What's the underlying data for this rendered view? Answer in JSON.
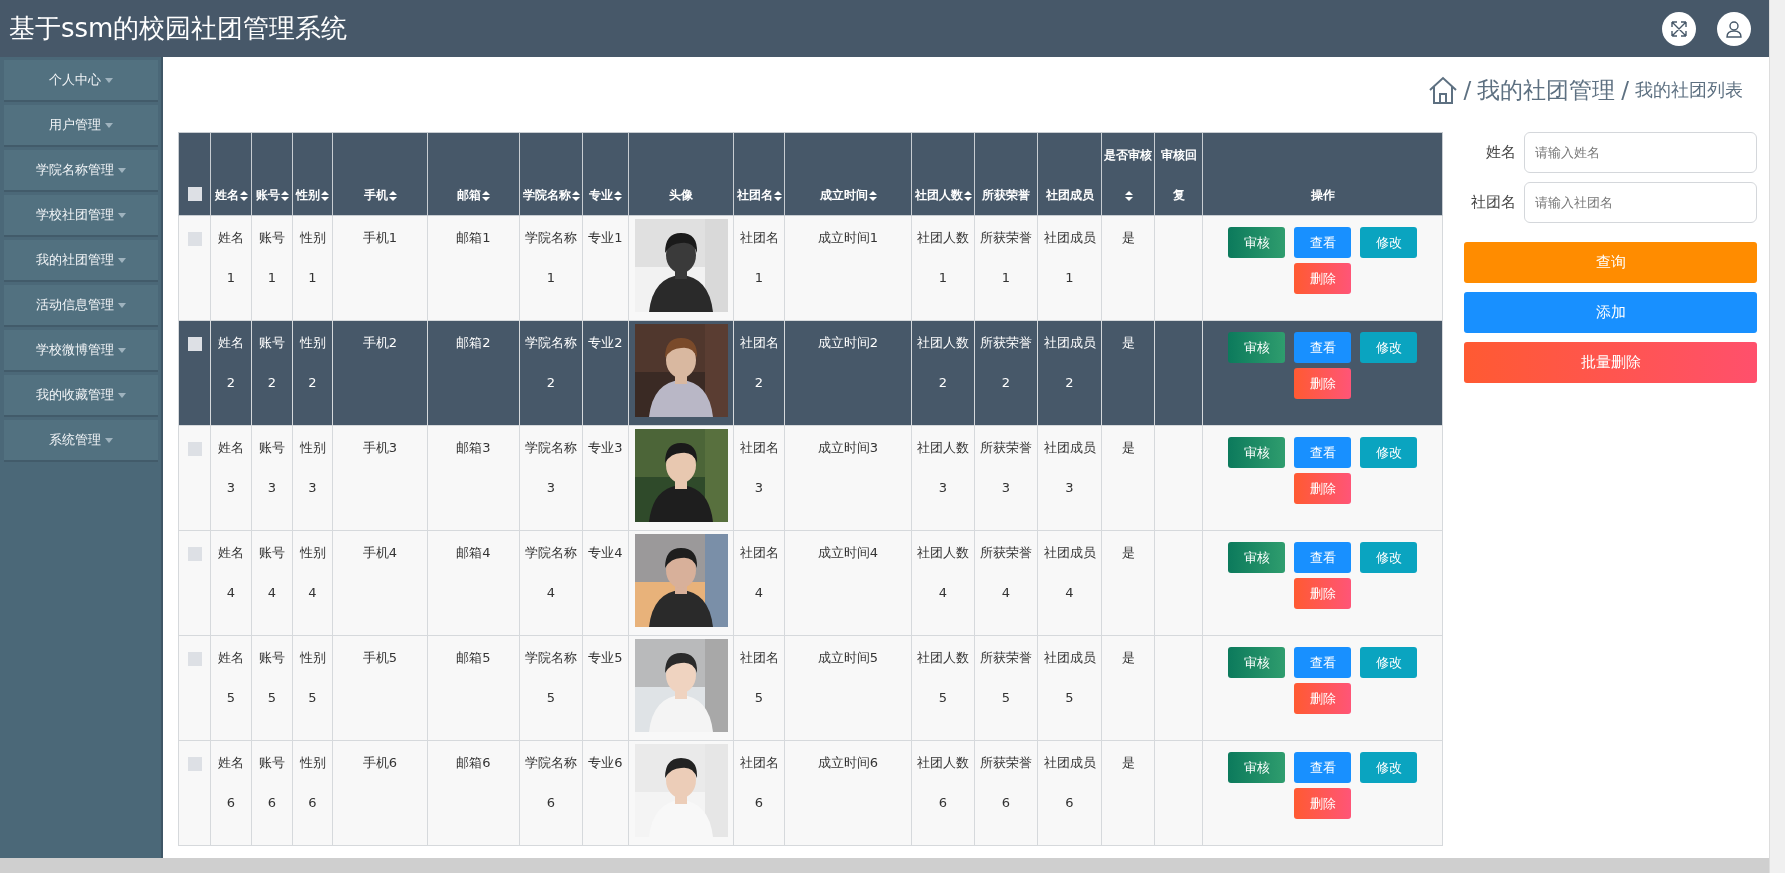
{
  "app": {
    "title": "基于ssm的校园社团管理系统"
  },
  "sidebar": {
    "items": [
      {
        "label": "个人中心"
      },
      {
        "label": "用户管理"
      },
      {
        "label": "学院名称管理"
      },
      {
        "label": "学校社团管理"
      },
      {
        "label": "我的社团管理"
      },
      {
        "label": "活动信息管理"
      },
      {
        "label": "学校微博管理"
      },
      {
        "label": "我的收藏管理"
      },
      {
        "label": "系统管理"
      }
    ]
  },
  "breadcrumb": {
    "parts": [
      {
        "kind": "separator",
        "text": "/"
      },
      {
        "kind": "section",
        "text": "我的社团管理"
      },
      {
        "kind": "separator",
        "text": "/"
      },
      {
        "kind": "page",
        "text": "我的社团列表"
      }
    ]
  },
  "table": {
    "header_checkbox": {
      "checked": false
    },
    "columns": [
      {
        "label": "姓名",
        "kind": "text",
        "sortable": true
      },
      {
        "label": "账号",
        "kind": "text",
        "sortable": true
      },
      {
        "label": "性别",
        "kind": "text",
        "sortable": true
      },
      {
        "label": "手机",
        "kind": "text",
        "sortable": true
      },
      {
        "label": "邮箱",
        "kind": "text",
        "sortable": true
      },
      {
        "label": "学院名称",
        "kind": "text",
        "sortable": true
      },
      {
        "label": "专业",
        "kind": "text",
        "sortable": true
      },
      {
        "label": "头像",
        "sortable": false
      },
      {
        "label": "社团名",
        "kind": "text",
        "sortable": true
      },
      {
        "label": "成立时间",
        "kind": "text",
        "sortable": true
      },
      {
        "label": "社团人数",
        "kind": "text",
        "sortable": true
      },
      {
        "label": "所获荣誉",
        "kind": "text",
        "sortable": false
      },
      {
        "label": "社团成员",
        "kind": "text",
        "sortable": false
      },
      {
        "label": "是否审核",
        "kind": "text",
        "sortable": true
      },
      {
        "label": "审核回复",
        "kind": "empty",
        "sortable": false
      },
      {
        "label": "操作",
        "kind": "actions",
        "sortable": false
      }
    ],
    "rows": [
      {
        "checked": false,
        "highlighted": false,
        "cells": [
          "姓名1",
          "账号1",
          "性别1",
          "手机1",
          "邮箱1",
          "学院名称1",
          "专业1",
          "",
          "社团名1",
          "成立时间1",
          "社团人数1",
          "所获荣誉1",
          "社团成员1",
          "是"
        ],
        "actions": [
          {
            "label": "审核",
            "kind": "review"
          },
          {
            "label": "查看",
            "kind": "view"
          },
          {
            "label": "修改",
            "kind": "edit"
          },
          {
            "label": "删除",
            "kind": "delete"
          }
        ]
      },
      {
        "checked": false,
        "highlighted": true,
        "cells": [
          "姓名2",
          "账号2",
          "性别2",
          "手机2",
          "邮箱2",
          "学院名称2",
          "专业2",
          "",
          "社团名2",
          "成立时间2",
          "社团人数2",
          "所获荣誉2",
          "社团成员2",
          "是"
        ],
        "actions": [
          {
            "label": "审核",
            "kind": "review"
          },
          {
            "label": "查看",
            "kind": "view"
          },
          {
            "label": "修改",
            "kind": "edit"
          },
          {
            "label": "删除",
            "kind": "delete"
          }
        ]
      },
      {
        "checked": false,
        "highlighted": false,
        "cells": [
          "姓名3",
          "账号3",
          "性别3",
          "手机3",
          "邮箱3",
          "学院名称3",
          "专业3",
          "",
          "社团名3",
          "成立时间3",
          "社团人数3",
          "所获荣誉3",
          "社团成员3",
          "是"
        ],
        "actions": [
          {
            "label": "审核",
            "kind": "review"
          },
          {
            "label": "查看",
            "kind": "view"
          },
          {
            "label": "修改",
            "kind": "edit"
          },
          {
            "label": "删除",
            "kind": "delete"
          }
        ]
      },
      {
        "checked": false,
        "highlighted": false,
        "cells": [
          "姓名4",
          "账号4",
          "性别4",
          "手机4",
          "邮箱4",
          "学院名称4",
          "专业4",
          "",
          "社团名4",
          "成立时间4",
          "社团人数4",
          "所获荣誉4",
          "社团成员4",
          "是"
        ],
        "actions": [
          {
            "label": "审核",
            "kind": "review"
          },
          {
            "label": "查看",
            "kind": "view"
          },
          {
            "label": "修改",
            "kind": "edit"
          },
          {
            "label": "删除",
            "kind": "delete"
          }
        ]
      },
      {
        "checked": false,
        "highlighted": false,
        "cells": [
          "姓名5",
          "账号5",
          "性别5",
          "手机5",
          "邮箱5",
          "学院名称5",
          "专业5",
          "",
          "社团名5",
          "成立时间5",
          "社团人数5",
          "所获荣誉5",
          "社团成员5",
          "是"
        ],
        "actions": [
          {
            "label": "审核",
            "kind": "review"
          },
          {
            "label": "查看",
            "kind": "view"
          },
          {
            "label": "修改",
            "kind": "edit"
          },
          {
            "label": "删除",
            "kind": "delete"
          }
        ]
      },
      {
        "checked": false,
        "highlighted": false,
        "cells": [
          "姓名6",
          "账号6",
          "性别6",
          "手机6",
          "邮箱6",
          "学院名称6",
          "专业6",
          "",
          "社团名6",
          "成立时间6",
          "社团人数6",
          "所获荣誉6",
          "社团成员6",
          "是"
        ],
        "actions": [
          {
            "label": "审核",
            "kind": "review"
          },
          {
            "label": "查看",
            "kind": "view"
          },
          {
            "label": "修改",
            "kind": "edit"
          },
          {
            "label": "删除",
            "kind": "delete"
          }
        ]
      }
    ]
  },
  "search_form": {
    "fields": [
      {
        "label": "姓名",
        "placeholder": "请输入姓名"
      },
      {
        "label": "社团名",
        "placeholder": "请输入社团名"
      }
    ],
    "buttons": [
      {
        "label": "查询",
        "kind": "search"
      },
      {
        "label": "添加",
        "kind": "add"
      },
      {
        "label": "批量删除",
        "kind": "batch-delete"
      }
    ]
  }
}
